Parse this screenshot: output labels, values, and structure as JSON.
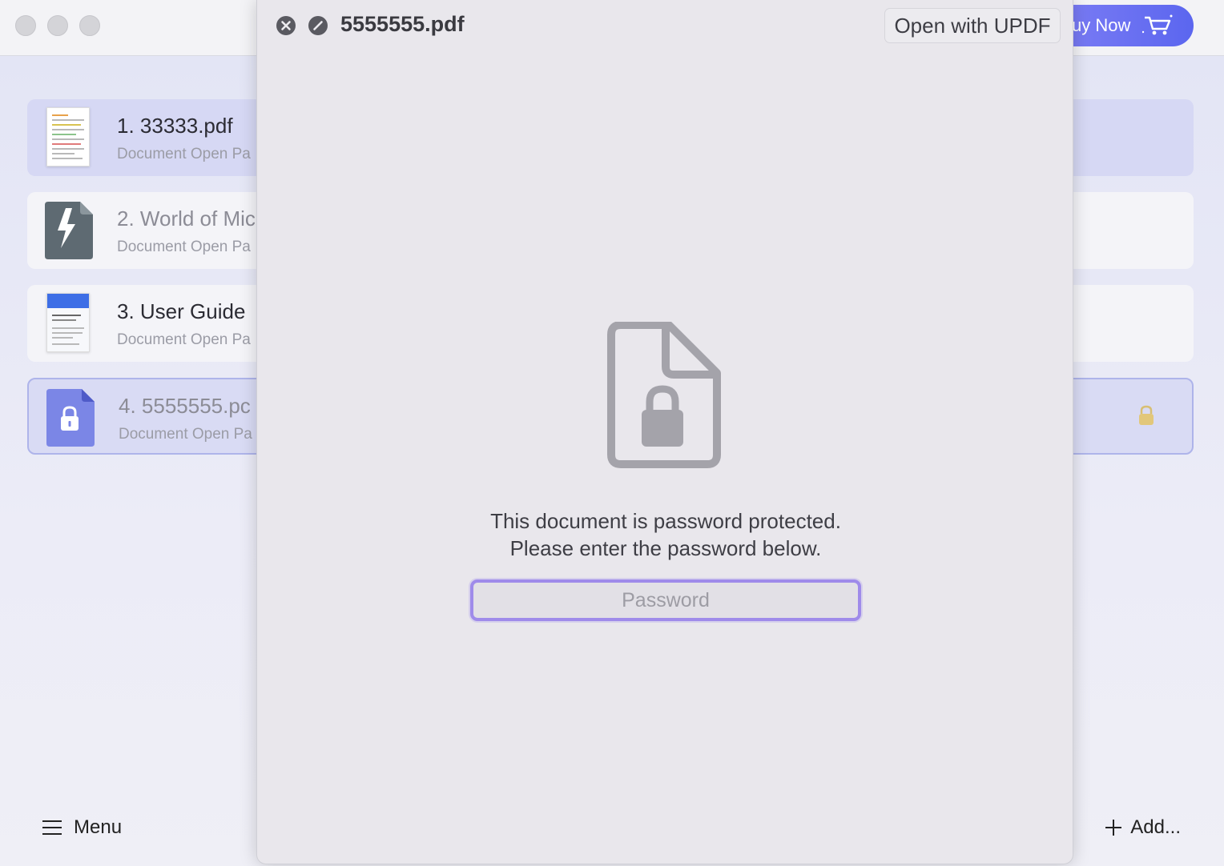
{
  "app": {
    "buy_label": "uy Now"
  },
  "documents": [
    {
      "name": "1. 33333.pdf",
      "subtitle": "Document Open Pa"
    },
    {
      "name": "2. World of Mic",
      "subtitle": "Document Open Pa"
    },
    {
      "name": "3. User Guide",
      "subtitle": "Document Open Pa"
    },
    {
      "name": "4. 5555555.pc",
      "subtitle": "Document Open Pa"
    }
  ],
  "footer": {
    "menu_label": "Menu",
    "add_label": "Add..."
  },
  "modal": {
    "file_name": "5555555.pdf",
    "open_with_label": "Open with UPDF",
    "message_line1": "This document is password protected.",
    "message_line2": "Please enter the password below.",
    "password_placeholder": "Password",
    "password_value": ""
  },
  "colors": {
    "accent": "#9f8bea",
    "buy_gradient_start": "#7f7ff5",
    "buy_gradient_end": "#5b66ef",
    "selected_row": "#d6d8f4",
    "lock_gold": "#e2c77a"
  }
}
